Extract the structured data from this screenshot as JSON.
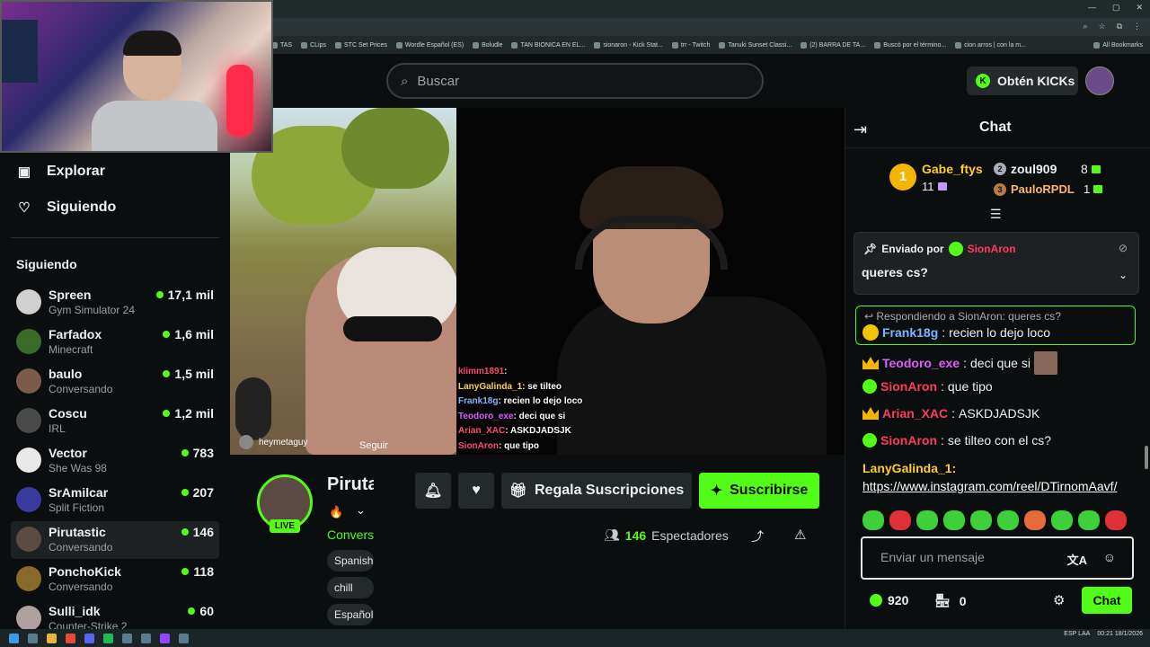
{
  "browser": {
    "bookmarks": [
      "TAS",
      "CLips",
      "STC Set Prices",
      "Wordle Español (ES)",
      "Boludle",
      "TAN BIONICA EN EL...",
      "sionaron - Kick Stat...",
      "trr - Twitch",
      "Tanuki Sunset Classi...",
      "(2) BARRA DE TA...",
      "Buscó por el término...",
      "cion arros | con la m..."
    ],
    "all_bookmarks": "All Bookmarks"
  },
  "topnav": {
    "search_placeholder": "Buscar",
    "kicks_label": "Obtén KICKs"
  },
  "sidebar": {
    "nav": [
      {
        "label": "Explorar",
        "icon": "explore-icon"
      },
      {
        "label": "Siguiendo",
        "icon": "heart-icon"
      }
    ],
    "following_header": "Siguiendo",
    "channels": [
      {
        "name": "Spreen",
        "game": "Gym Simulator 24",
        "viewers": "17,1 mil"
      },
      {
        "name": "Farfadox",
        "game": "Minecraft",
        "viewers": "1,6 mil"
      },
      {
        "name": "baulo",
        "game": "Conversando",
        "viewers": "1,5 mil"
      },
      {
        "name": "Coscu",
        "game": "IRL",
        "viewers": "1,2 mil"
      },
      {
        "name": "Vector",
        "game": "She Was 98",
        "viewers": "783"
      },
      {
        "name": "SrAmilcar",
        "game": "Split Fiction",
        "viewers": "207"
      },
      {
        "name": "Pirutastic",
        "game": "Conversando",
        "viewers": "146"
      },
      {
        "name": "PonchoKick",
        "game": "Conversando",
        "viewers": "118"
      },
      {
        "name": "Sulli_idk",
        "game": "Counter-Strike 2",
        "viewers": "60"
      }
    ]
  },
  "video": {
    "follow_user": "heymetaguy",
    "follow_button": "Seguir",
    "overlay_chat": [
      {
        "user": "kiimm1891",
        "msg": ""
      },
      {
        "user": "LanyGalinda_1",
        "msg": "se tilteo"
      },
      {
        "user": "Frank18g",
        "msg": "recien lo dejo loco"
      },
      {
        "user": "Teodoro_exe",
        "msg": "deci que si"
      },
      {
        "user": "Arian_XAC",
        "msg": "ASKDJADSJK"
      },
      {
        "user": "SionAron",
        "msg": "que tipo"
      }
    ]
  },
  "stream": {
    "name": "Pirutastic",
    "live": "LIVE",
    "category": "Conversando",
    "tags": [
      "Spanish",
      "chill",
      "Español"
    ],
    "gift_button": "Regala Suscripciones",
    "subscribe_button": "Suscribirse",
    "viewers_count": "146",
    "viewers_label": "Espectadores"
  },
  "chat": {
    "title": "Chat",
    "top_gifters": [
      {
        "rank": "1",
        "name": "Gabe_ftys",
        "count": "11"
      },
      {
        "rank": "2",
        "name": "zoul909",
        "count": "8"
      },
      {
        "rank": "3",
        "name": "PauloRPDL",
        "count": "1"
      }
    ],
    "pinned": {
      "prefix": "Enviado por",
      "author": "SionAron",
      "message": "queres cs?"
    },
    "reply": {
      "context": "Respondiendo a SionAron: queres cs?",
      "user": "Frank18g",
      "message": "recien lo dejo loco"
    },
    "messages": [
      {
        "user": "Teodoro_exe",
        "message": "deci que si"
      },
      {
        "user": "SionAron",
        "message": "que tipo"
      },
      {
        "user": "Arian_XAC",
        "message": "ASKDJADSJK"
      },
      {
        "user": "SionAron",
        "message": "se tilteo con el cs?"
      }
    ],
    "link_message": {
      "user": "LanyGalinda_1:",
      "link": "https://www.instagram.com/reel/DTirnomAavf/"
    },
    "input_placeholder": "Enviar un mensaje",
    "points": "920",
    "store_count": "0",
    "send_button": "Chat"
  },
  "taskbar": {
    "lang": "ESP LAA",
    "time": "00:21",
    "date": "18/1/2026"
  },
  "colors": {
    "accent": "#53fc18",
    "background": "#0b0e0f",
    "panel": "#24292b"
  }
}
